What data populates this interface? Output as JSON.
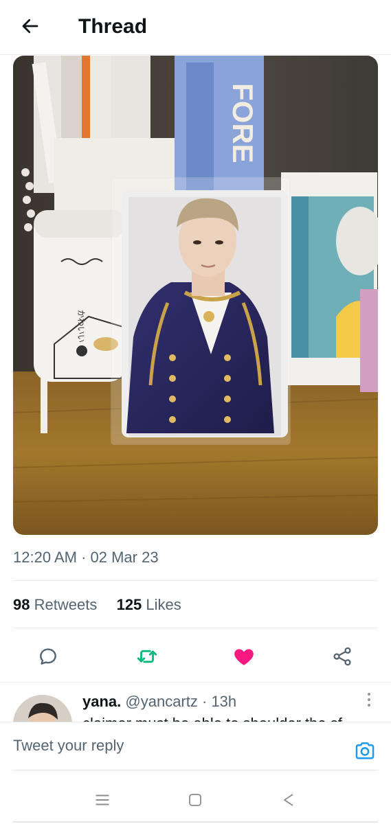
{
  "header": {
    "title": "Thread",
    "back_icon": "arrow-left-icon"
  },
  "tweet": {
    "media": {
      "alt": "photocard on desk"
    },
    "timestamp": "12:20 AM · 02 Mar 23",
    "stats": {
      "retweets_count": "98",
      "retweets_label": "Retweets",
      "likes_count": "125",
      "likes_label": "Likes"
    },
    "actions": {
      "reply_icon": "reply-bubble-icon",
      "retweet_icon": "retweet-icon",
      "like_icon": "heart-filled-icon",
      "share_icon": "share-icon"
    }
  },
  "reply": {
    "name": "yana.",
    "handle": "@yancartz",
    "time": "· 13h",
    "text": "claimer must be able to shoulder the sf"
  },
  "compose": {
    "placeholder": "Tweet your reply",
    "camera_icon": "camera-icon"
  },
  "colors": {
    "retweet_active": "#00ba7c",
    "like_active": "#f91880",
    "accent": "#1d9bf0",
    "secondary_text": "#536471"
  },
  "system_nav": {
    "menu_icon": "menu-icon",
    "home_icon": "home-square-icon",
    "back_icon": "back-triangle-icon"
  }
}
